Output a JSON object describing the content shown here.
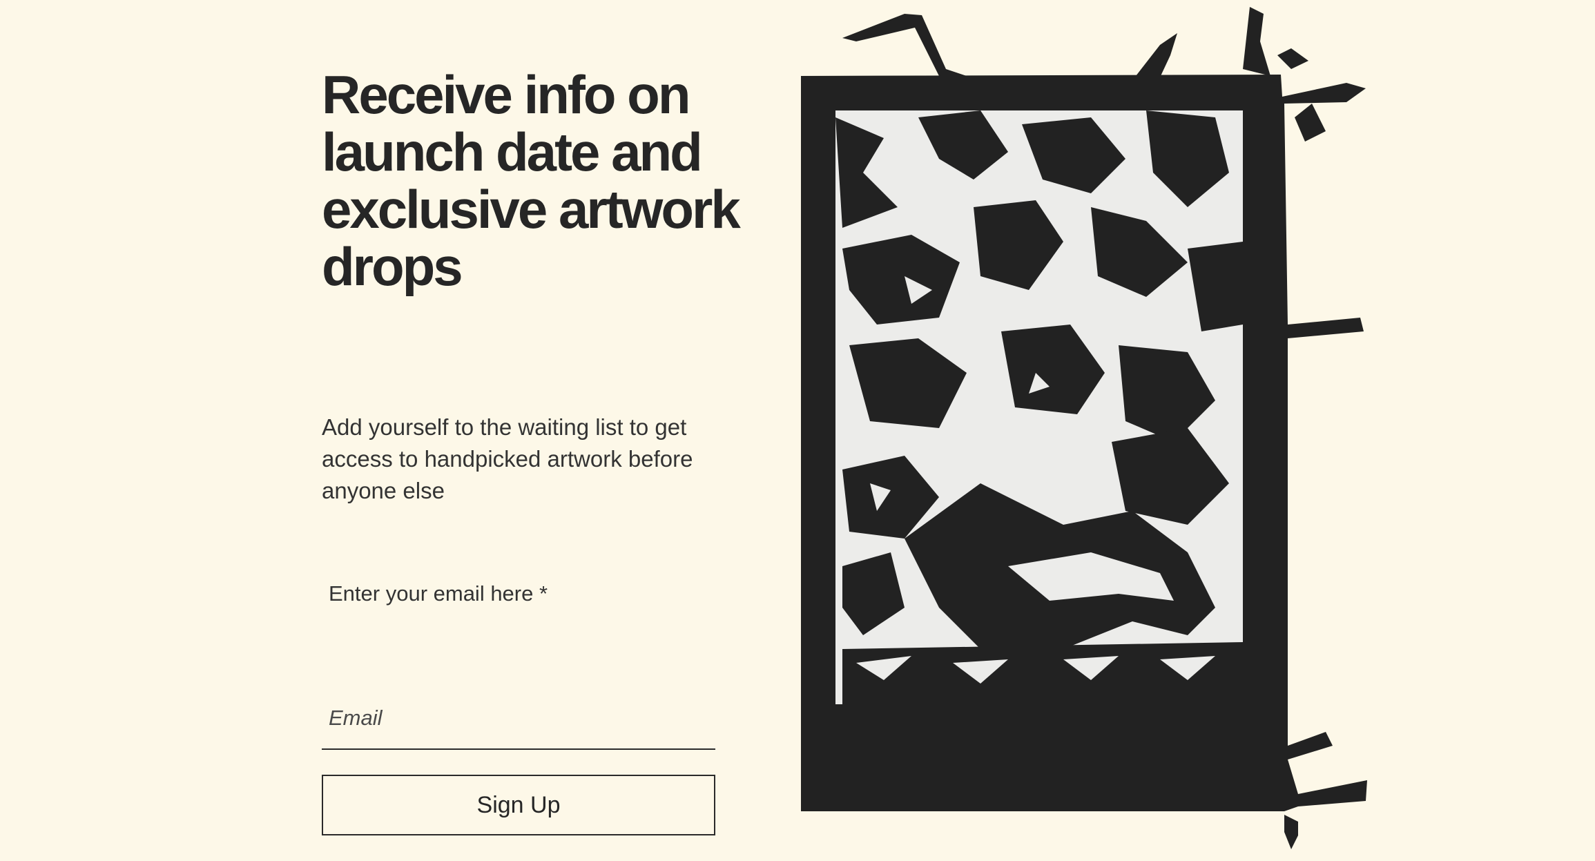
{
  "signup": {
    "headline": "Receive info on launch date and exclusive artwork drops",
    "description": "Add yourself to the waiting list to get access to handpicked artwork before anyone else",
    "email_label": "Enter your email here *",
    "email_placeholder": "Email",
    "email_value": "",
    "button_label": "Sign Up"
  },
  "artwork": {
    "description": "black-and-white linocut print with flowers and a small animal",
    "colors": {
      "ink": "#222222",
      "paper": "#ececea"
    }
  },
  "theme": {
    "background": "#fdf8e8",
    "text": "#262626"
  }
}
